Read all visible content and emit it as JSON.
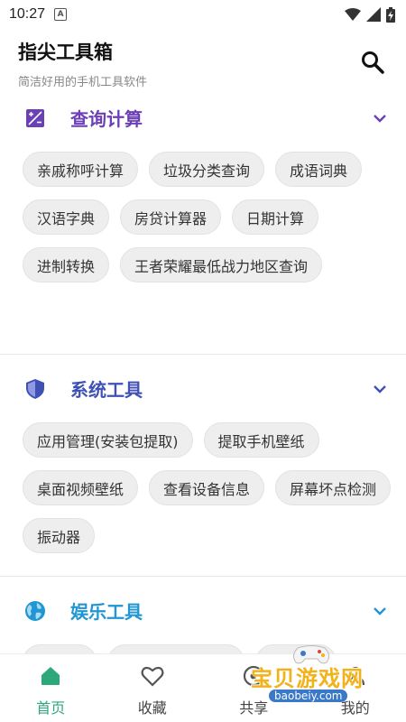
{
  "status_bar": {
    "time": "10:27",
    "notification": "A"
  },
  "header": {
    "title": "指尖工具箱",
    "subtitle": "简洁好用的手机工具软件"
  },
  "sections": [
    {
      "title": "查询计算",
      "color": "#6b3fb5",
      "icon": "calculator-icon",
      "chips": [
        "亲戚称呼计算",
        "垃圾分类查询",
        "成语词典",
        "汉语字典",
        "房贷计算器",
        "日期计算",
        "进制转换",
        "王者荣耀最低战力地区查询"
      ]
    },
    {
      "title": "系统工具",
      "color": "#3f51b5",
      "icon": "shield-icon",
      "chips": [
        "应用管理(安装包提取)",
        "提取手机壁纸",
        "桌面视频壁纸",
        "查看设备信息",
        "屏幕坏点检测",
        "振动器"
      ]
    },
    {
      "title": "娱乐工具",
      "color": "#2196d3",
      "icon": "globe-icon",
      "chips": [
        "",
        "",
        ""
      ]
    }
  ],
  "nav": {
    "items": [
      {
        "label": "首页",
        "icon": "home-icon",
        "active": true
      },
      {
        "label": "收藏",
        "icon": "heart-icon",
        "active": false
      },
      {
        "label": "共享",
        "icon": "share-icon",
        "active": false
      },
      {
        "label": "我的",
        "icon": "person-icon",
        "active": false
      }
    ],
    "active_color": "#2ea87a"
  },
  "watermark": {
    "text": "宝贝游戏网",
    "url": "baobeiy.com"
  }
}
